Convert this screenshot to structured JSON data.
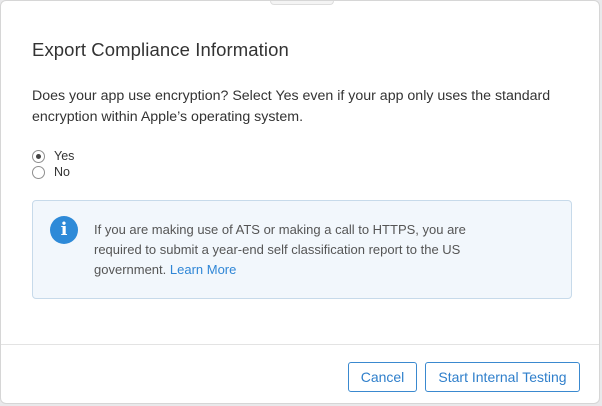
{
  "dialog": {
    "title": "Export Compliance Information",
    "question": "Does your app use encryption? Select Yes even if your app only uses the standard encryption within Apple’s operating system."
  },
  "radio": {
    "options": [
      {
        "label": "Yes",
        "checked": true
      },
      {
        "label": "No",
        "checked": false
      }
    ]
  },
  "info": {
    "icon": "info-icon",
    "glyph": "i",
    "text": "If you are making use of ATS or making a call to HTTPS, you are required to submit a year-end self classification report to the US government.",
    "link_label": "Learn More"
  },
  "buttons": {
    "cancel_label": "Cancel",
    "start_label": "Start Internal Testing"
  },
  "colors": {
    "accent": "#2f7fcb",
    "info_background": "#f2f7fc",
    "info_border": "#c7daea",
    "info_icon": "#2e8ad8"
  }
}
